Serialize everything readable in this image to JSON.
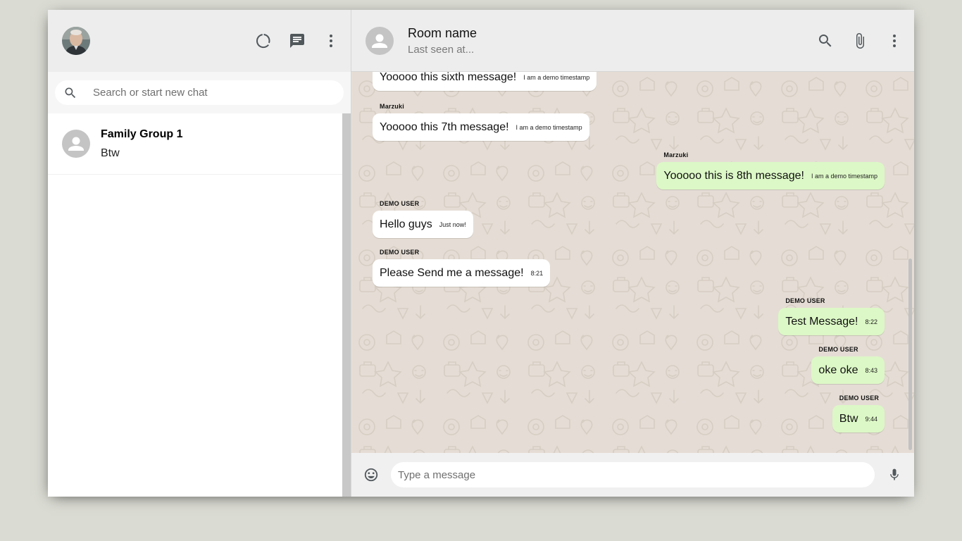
{
  "sidebar": {
    "search": {
      "placeholder": "Search or start new chat",
      "value": ""
    },
    "chats": [
      {
        "name": "Family Group 1",
        "last_message": "Btw"
      }
    ]
  },
  "chat": {
    "room_name": "Room name",
    "last_seen": "Last seen at...",
    "messages": [
      {
        "sender": "",
        "text": "Yooooo this sixth message!",
        "time": "I am a demo timestamp",
        "sent": false
      },
      {
        "sender": "Marzuki",
        "text": "Yooooo this 7th message!",
        "time": "I am a demo timestamp",
        "sent": false
      },
      {
        "sender": "Marzuki",
        "text": "Yooooo this is 8th message!",
        "time": "I am a demo timestamp",
        "sent": true
      },
      {
        "sender": "DEMO USER",
        "text": "Hello guys",
        "time": "Just now!",
        "sent": false
      },
      {
        "sender": "DEMO USER",
        "text": "Please Send me a message!",
        "time": "8:21",
        "sent": false
      },
      {
        "sender": "DEMO USER",
        "text": "Test Message!",
        "time": "8:22",
        "sent": true
      },
      {
        "sender": "DEMO USER",
        "text": "oke oke",
        "time": "8:43",
        "sent": true
      },
      {
        "sender": "DEMO USER",
        "text": "Btw",
        "time": "9:44",
        "sent": true
      }
    ],
    "input": {
      "placeholder": "Type a message",
      "value": ""
    }
  },
  "colors": {
    "background": "#dadbd3",
    "sent_bubble": "#dcf8c6",
    "received_bubble": "#ffffff",
    "chat_background": "#e5ddd5",
    "header": "#ededed"
  },
  "icons": {
    "sidebar_header": [
      "status-icon",
      "new-chat-icon",
      "more-vert-icon"
    ],
    "chat_header": [
      "search-icon",
      "attach-icon",
      "more-vert-icon"
    ],
    "footer": [
      "emoji-icon",
      "mic-icon"
    ]
  }
}
